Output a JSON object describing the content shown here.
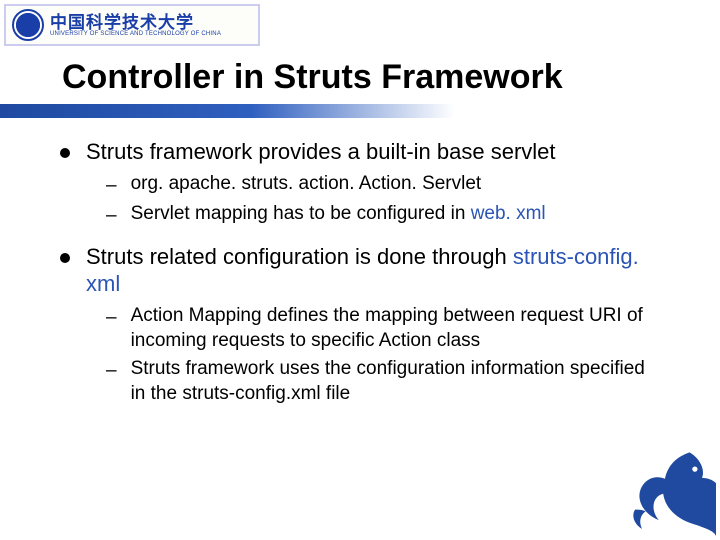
{
  "logo": {
    "cn": "中国科学技术大学",
    "en": "UNIVERSITY OF SCIENCE AND TECHNOLOGY OF CHINA"
  },
  "title": "Controller in Struts Framework",
  "bullets": [
    {
      "text": "Struts framework provides a built-in base servlet",
      "children": [
        {
          "plain": "org. apache. struts. action. Action. Servlet"
        },
        {
          "before": "Servlet mapping has to be configured in ",
          "accent": "web. xml"
        }
      ]
    },
    {
      "before": "Struts related configuration is done through ",
      "accent": "struts-config. xml",
      "children": [
        {
          "plain": "Action Mapping defines the mapping between request URI of incoming requests to specific Action class"
        },
        {
          "plain": "Struts framework uses the configuration information specified in the struts-config.xml file"
        }
      ]
    }
  ]
}
